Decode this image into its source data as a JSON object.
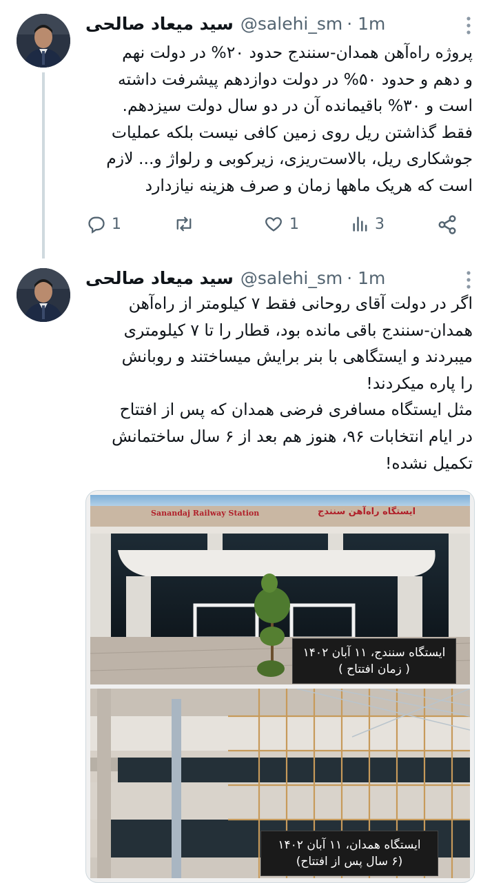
{
  "tweets": [
    {
      "author_name": "سید میعاد صالحی",
      "handle": "@salehi_sm",
      "time": "· 1m",
      "text": "پروژه راه‌آهن همدان-سنندج حدود ۲۰% در دولت نهم\nو دهم و حدود ۵۰% در دولت دوازدهم پیشرفت داشته\nاست و ۳۰% باقیمانده آن در دو سال دولت سیزدهم.\nفقط گذاشتن ریل روی زمین کافی نیست بلکه عملیات\nجوشکاری ریل، بالاست‌ریزی، زیرکوبی و رلواژ و... لازم\nاست که هریک ماهها زمان و صرف هزینه نیازدارد",
      "actions": {
        "replies": "1",
        "likes": "1",
        "views": "3"
      }
    },
    {
      "author_name": "سید میعاد صالحی",
      "handle": "@salehi_sm",
      "time": "· 1m",
      "text": "اگر در دولت آقای روحانی فقط ۷ کیلومتر از راه‌آهن\nهمدان-سنندج باقی مانده بود، قطار را تا ۷ کیلومتری\nمیبردند و ایستگاهی با بنر برایش میساختند و روبانش\nرا پاره میکردند!\nمثل ایستگاه مسافری فرضی همدان که پس از افتتاح\nدر ایام انتخابات ۹۶، هنوز هم بعد از ۶ سال ساختمانش\nتکمیل نشده!",
      "media": {
        "top_sign_en": "Sanandaj Railway Station",
        "top_sign_fa": "ایستگاه راه‌آهن سنندج",
        "top_caption_line1": "ایستگاه سنندج، ۱۱ آبان ۱۴۰۲",
        "top_caption_line2": "( زمان افتتاح )",
        "bottom_caption_line1": "ایستگاه همدان، ۱۱ آبان ۱۴۰۲",
        "bottom_caption_line2": "(۶ سال پس از افتتاح)"
      }
    }
  ]
}
